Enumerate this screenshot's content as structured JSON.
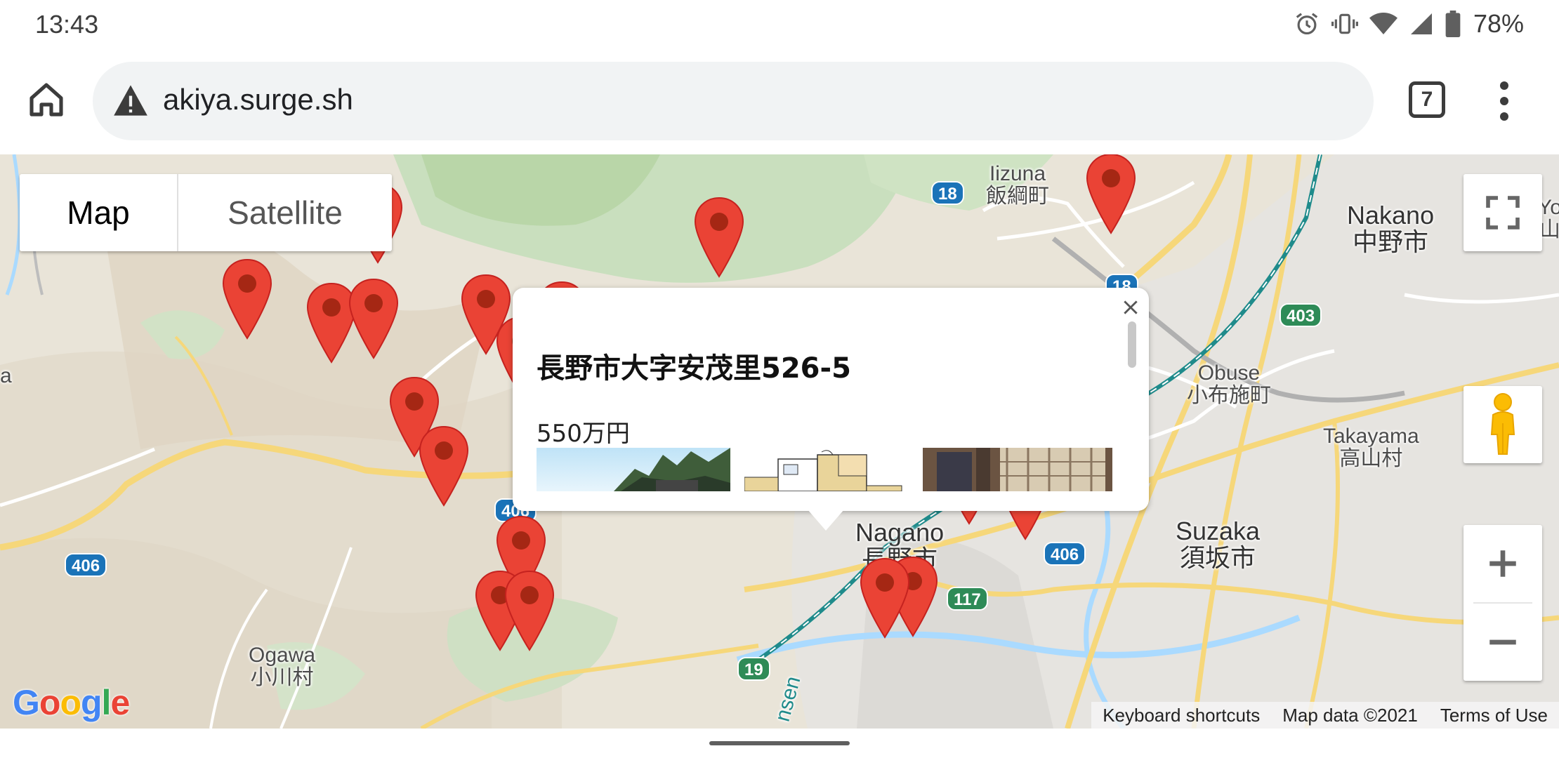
{
  "status_bar": {
    "time": "13:43",
    "battery": "78%",
    "icons": [
      "alarm-icon",
      "vibrate-icon",
      "wifi-icon",
      "signal-icon",
      "battery-icon"
    ]
  },
  "browser": {
    "url": "akiya.surge.sh",
    "tab_count": "7",
    "security_icon": "warning-icon"
  },
  "map": {
    "type_control": {
      "map_label": "Map",
      "satellite_label": "Satellite",
      "selected": "Map"
    },
    "labels": {
      "iizuna": "Iizuna",
      "iizuna_jp": "飯綱町",
      "nakano": "Nakano",
      "nakano_jp": "中野市",
      "obuse": "Obuse",
      "obuse_jp": "小布施町",
      "takayama": "Takayama",
      "takayama_jp": "高山村",
      "suzaka": "Suzaka",
      "suzaka_jp": "須坂市",
      "nagano": "Nagano",
      "nagano_jp": "長野市",
      "ogawa": "Ogawa",
      "ogawa_jp": "小川村",
      "edge_right": "Yo",
      "edge_right_jp": "山",
      "edge_left": "a",
      "rail": "nsen"
    },
    "route_shields": [
      "18",
      "18",
      "403",
      "406",
      "406",
      "406",
      "117",
      "19"
    ],
    "attribution": {
      "logo": "Google",
      "keyboard": "Keyboard shortcuts",
      "data": "Map data ©2021",
      "terms": "Terms of Use"
    },
    "colors": {
      "pin": "#ea4335",
      "pin_dot": "#a52714",
      "water": "#aadaff",
      "highway": "#fcd56a"
    }
  },
  "info_window": {
    "title": "長野市大字安茂里526-5",
    "price": "550万円",
    "photos": [
      "house-exterior-photo",
      "floor-plan-photo",
      "interior-photo"
    ]
  }
}
